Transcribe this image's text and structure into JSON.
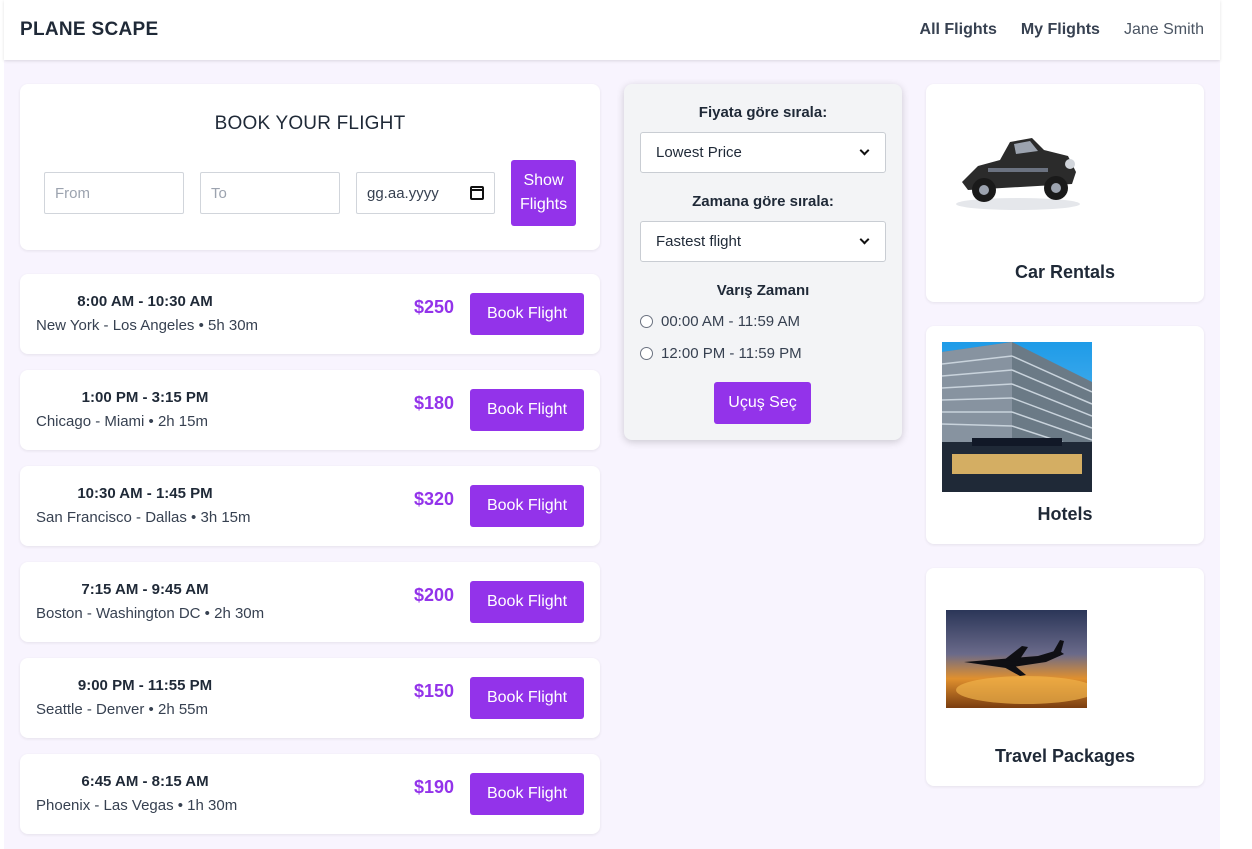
{
  "nav": {
    "brand": "PLANE SCAPE",
    "all_flights": "All Flights",
    "my_flights": "My Flights",
    "user": "Jane Smith"
  },
  "booking": {
    "title": "BOOK YOUR FLIGHT",
    "from_placeholder": "From",
    "to_placeholder": "To",
    "date_placeholder": "gg.aa.yyyy",
    "show_button": "Show Flights"
  },
  "flights": [
    {
      "time": "8:00 AM - 10:30 AM",
      "route": "New York - Los Angeles • 5h 30m",
      "price": "$250",
      "button": "Book Flight"
    },
    {
      "time": "1:00 PM - 3:15 PM",
      "route": "Chicago - Miami • 2h 15m",
      "price": "$180",
      "button": "Book Flight"
    },
    {
      "time": "10:30 AM - 1:45 PM",
      "route": "San Francisco - Dallas • 3h 15m",
      "price": "$320",
      "button": "Book Flight"
    },
    {
      "time": "7:15 AM - 9:45 AM",
      "route": "Boston - Washington DC • 2h 30m",
      "price": "$200",
      "button": "Book Flight"
    },
    {
      "time": "9:00 PM - 11:55 PM",
      "route": "Seattle - Denver • 2h 55m",
      "price": "$150",
      "button": "Book Flight"
    },
    {
      "time": "6:45 AM - 8:15 AM",
      "route": "Phoenix - Las Vegas • 1h 30m",
      "price": "$190",
      "button": "Book Flight"
    }
  ],
  "filter": {
    "price_label": "Fiyata göre sırala:",
    "price_value": "Lowest Price",
    "time_label": "Zamana göre sırala:",
    "time_value": "Fastest flight",
    "arrival_label": "Varış Zamanı",
    "arrival_options": [
      "00:00 AM - 11:59 AM",
      "12:00 PM - 11:59 PM"
    ],
    "select_button": "Uçuş Seç"
  },
  "side_cards": [
    {
      "title": "Car Rentals",
      "image": "vintage-car-image"
    },
    {
      "title": "Hotels",
      "image": "hotel-building-image"
    },
    {
      "title": "Travel Packages",
      "image": "airplane-sunset-image"
    }
  ],
  "colors": {
    "accent": "#9333ea",
    "page_bg": "#f8f4fe",
    "panel_bg": "#f3f4f6"
  }
}
